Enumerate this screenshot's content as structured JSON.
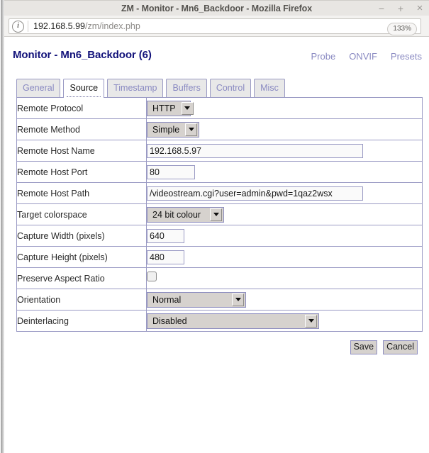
{
  "window": {
    "title": "ZM - Monitor - Mn6_Backdoor - Mozilla Firefox",
    "minimize_label": "−",
    "maximize_label": "+",
    "close_label": "×"
  },
  "browser": {
    "identity_icon": "info-icon",
    "url_host": "192.168.5.99",
    "url_path": "/zm/index.php",
    "zoom_level": "133%"
  },
  "page": {
    "title": "Monitor - Mn6_Backdoor (6)",
    "links": [
      {
        "label": "Probe"
      },
      {
        "label": "ONVIF"
      },
      {
        "label": "Presets"
      }
    ],
    "tabs": [
      {
        "label": "General",
        "active": false
      },
      {
        "label": "Source",
        "active": true
      },
      {
        "label": "Timestamp",
        "active": false
      },
      {
        "label": "Buffers",
        "active": false
      },
      {
        "label": "Control",
        "active": false
      },
      {
        "label": "Misc",
        "active": false
      }
    ],
    "fields": {
      "remote_protocol": {
        "label": "Remote Protocol",
        "value": "HTTP"
      },
      "remote_method": {
        "label": "Remote Method",
        "value": "Simple"
      },
      "remote_host_name": {
        "label": "Remote Host Name",
        "value": "192.168.5.97"
      },
      "remote_host_port": {
        "label": "Remote Host Port",
        "value": "80"
      },
      "remote_host_path": {
        "label": "Remote Host Path",
        "value": "/videostream.cgi?user=admin&pwd=1qaz2wsx"
      },
      "target_colorspace": {
        "label": "Target colorspace",
        "value": "24 bit colour"
      },
      "capture_width": {
        "label": "Capture Width (pixels)",
        "value": "640"
      },
      "capture_height": {
        "label": "Capture Height (pixels)",
        "value": "480"
      },
      "preserve_aspect_ratio": {
        "label": "Preserve Aspect Ratio",
        "checked": false
      },
      "orientation": {
        "label": "Orientation",
        "value": "Normal"
      },
      "deinterlacing": {
        "label": "Deinterlacing",
        "value": "Disabled"
      }
    },
    "buttons": {
      "save": "Save",
      "cancel": "Cancel"
    }
  },
  "colors": {
    "title_blue": "#12127a",
    "link_purple": "#8a8ac2",
    "table_border": "#9a9ac4",
    "control_face": "#d6d2ce"
  }
}
